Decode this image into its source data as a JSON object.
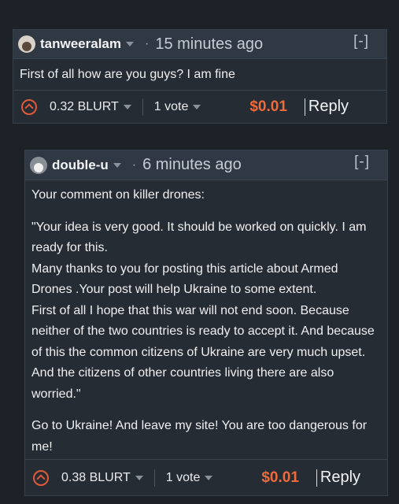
{
  "comment1": {
    "author": "tanweeralam",
    "dot": "·",
    "time": "15 minutes ago",
    "collapse": "[-]",
    "paragraphs": [
      "First of all how are you guys? I am fine"
    ],
    "payout": "0.32 BLURT",
    "votes": "1 vote",
    "amount": "$0.01",
    "reply": "Reply"
  },
  "comment2": {
    "author": "double-u",
    "dot": "·",
    "time": "6 minutes ago",
    "collapse": "[-]",
    "paragraphs": [
      "Your comment on killer drones:",
      "\"Your idea is very good. It should be worked on quickly. I am ready for this.\nMany thanks to you for posting this article about Armed Drones .Your post will help Ukraine to some extent.\nFirst of all I hope that this war will not end soon. Because neither of the two countries is ready to accept it. And because of this the common citizens of Ukraine are very much upset. And the citizens of other countries living there are also worried.\"",
      "Go to Ukraine! And leave my site! You are too dangerous for me!"
    ],
    "payout": "0.38 BLURT",
    "votes": "1 vote",
    "amount": "$0.01",
    "reply": "Reply"
  },
  "colors": {
    "accent": "#ef6b3c",
    "background": "#1d2228",
    "card": "#262c33"
  },
  "icons": {
    "upvote": "upvote-chevron-icon",
    "dropdown": "chevron-down-icon"
  }
}
